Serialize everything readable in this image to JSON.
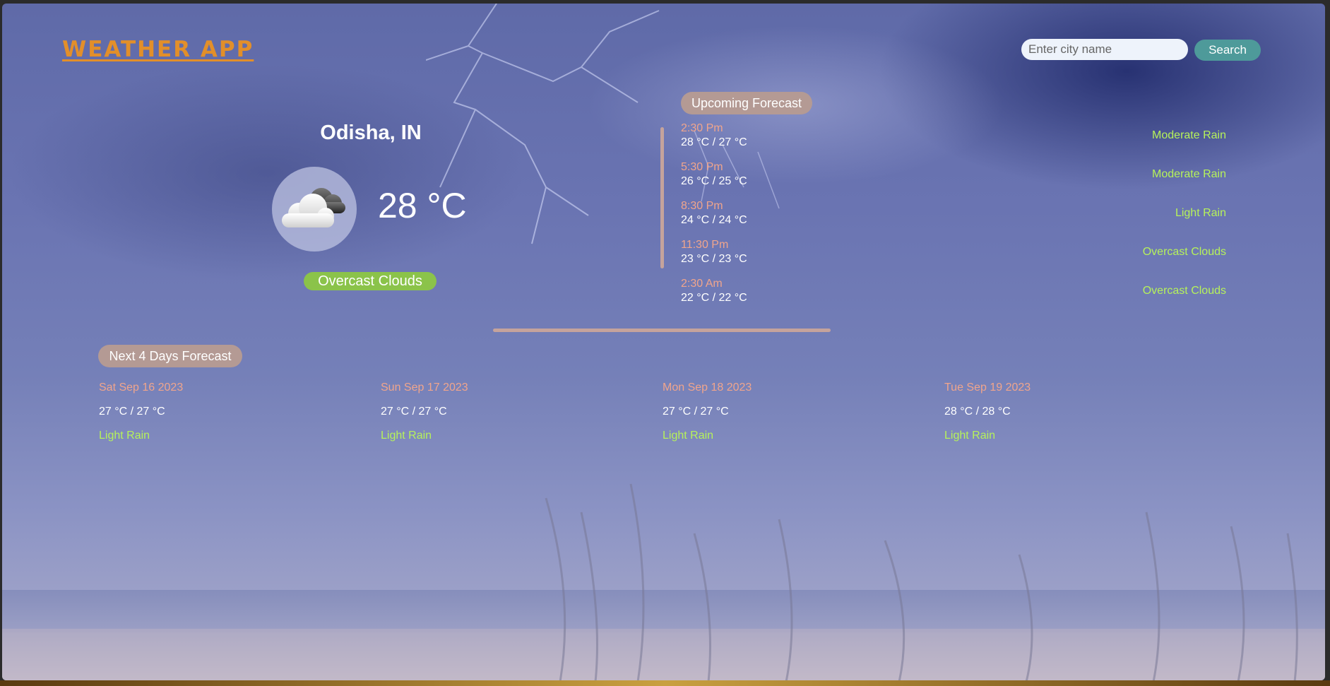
{
  "app": {
    "title": "WEATHER APP"
  },
  "search": {
    "placeholder": "Enter city name",
    "button_label": "Search"
  },
  "current": {
    "city": "Odisha, IN",
    "temp": "28 °C",
    "description": "Overcast Clouds",
    "icon": "overcast-cloud-icon"
  },
  "upcoming": {
    "title": "Upcoming Forecast",
    "items": [
      {
        "time": "2:30 Pm",
        "range": "28 °C / 27 °C",
        "desc": "Moderate Rain"
      },
      {
        "time": "5:30 Pm",
        "range": "26 °C / 25 °C",
        "desc": "Moderate Rain"
      },
      {
        "time": "8:30 Pm",
        "range": "24 °C / 24 °C",
        "desc": "Light Rain"
      },
      {
        "time": "11:30 Pm",
        "range": "23 °C / 23 °C",
        "desc": "Overcast Clouds"
      },
      {
        "time": "2:30 Am",
        "range": "22 °C / 22 °C",
        "desc": "Overcast Clouds"
      }
    ]
  },
  "days": {
    "title": "Next 4 Days Forecast",
    "items": [
      {
        "date": "Sat Sep 16 2023",
        "range": "27 °C / 27 °C",
        "desc": "Light Rain"
      },
      {
        "date": "Sun Sep 17 2023",
        "range": "27 °C / 27 °C",
        "desc": "Light Rain"
      },
      {
        "date": "Mon Sep 18 2023",
        "range": "27 °C / 27 °C",
        "desc": "Light Rain"
      },
      {
        "date": "Tue Sep 19 2023",
        "range": "28 °C / 28 °C",
        "desc": "Light Rain"
      }
    ]
  },
  "colors": {
    "logo": "#e28f2a",
    "accent_pill": "#b49a94",
    "search_button": "#4e9a9a",
    "desc_badge": "#8bc34a",
    "time_text": "#f0a58c",
    "desc_text": "#b6f25a"
  }
}
